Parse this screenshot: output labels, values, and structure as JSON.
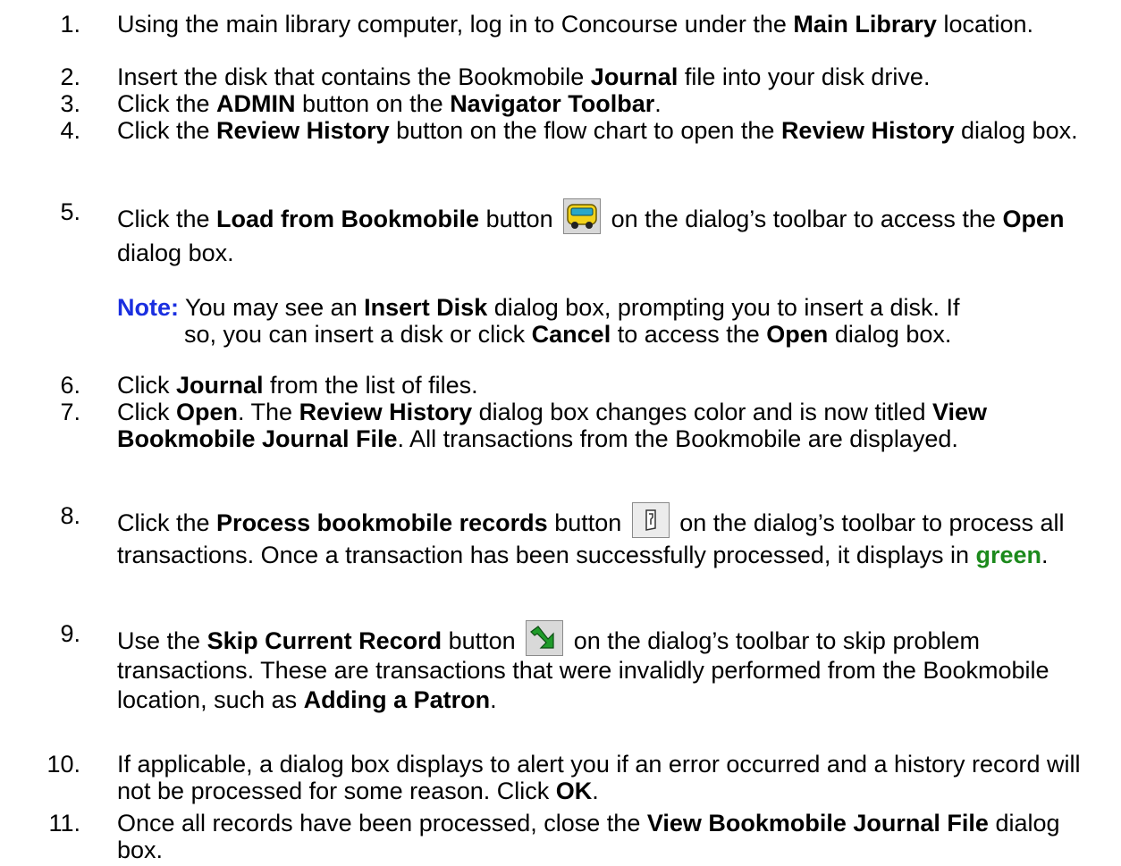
{
  "steps": [
    {
      "num": "1.",
      "pre": "Using the main library computer, log in to Concourse under the ",
      "b1": "Main Library",
      "post": " location."
    },
    {
      "num": "2.",
      "pre": "Insert the disk that contains the Bookmobile ",
      "b1": "Journal",
      "post": " file into your disk drive."
    },
    {
      "num": "3.",
      "pre": "Click the ",
      "b1": "ADMIN",
      "mid": " button on the ",
      "b2": "Navigator Toolbar",
      "post": "."
    },
    {
      "num": "4.",
      "pre": "Click the ",
      "b1": "Review History",
      "mid": " button on the flow chart to open the ",
      "b2": "Review History",
      "post": " dialog box."
    },
    {
      "num": "5.",
      "pre": "Click the ",
      "b1": "Load from Bookmobile",
      "mid": " button ",
      "icon": "bookmobile-bus-icon",
      "mid2": " on the dialog’s toolbar to access the ",
      "b2": "Open",
      "post": " dialog box."
    },
    {
      "num": "6.",
      "pre": "Click ",
      "b1": "Journal",
      "post": " from the list of files."
    },
    {
      "num": "7.",
      "pre": "Click ",
      "b1": "Open",
      "mid": ". The ",
      "b2": "Review History",
      "mid2": " dialog box changes color and is now titled ",
      "b3": "View Bookmobile Journal File",
      "post": ". All transactions from the Bookmobile are displayed."
    },
    {
      "num": "8.",
      "pre": "Click the ",
      "b1": "Process bookmobile records",
      "mid": " button ",
      "icon": "process-records-icon",
      "mid2": " on the dialog’s toolbar to process all transactions. Once a transaction has been successfully processed, it displays in ",
      "green": "green",
      "post": "."
    },
    {
      "num": "9.",
      "pre": "Use the ",
      "b1": "Skip Current Record",
      "mid": " button ",
      "icon": "skip-record-arrow-icon",
      "mid2": " on the dialog’s toolbar to skip problem transactions. These are transactions that were invalidly performed from the Bookmobile location, such as ",
      "b2": "Adding a Patron",
      "post": "."
    },
    {
      "num": "10.",
      "pre": "If applicable, a dialog box displays to alert you if an error occurred and a history record will not be processed for some reason. Click ",
      "b1": "OK",
      "post": "."
    },
    {
      "num": "11.",
      "pre": "Once all records have been processed, close the ",
      "b1": "View Bookmobile Journal File",
      "post": " dialog box."
    }
  ],
  "note": {
    "label": "Note:",
    "line1_pre": " You may see an ",
    "line1_b": "Insert Disk",
    "line1_post": " dialog box, prompting you to insert a disk. If",
    "line2_pre": "so, you can insert a disk or click ",
    "line2_b1": "Cancel",
    "line2_mid": " to access the ",
    "line2_b2": "Open",
    "line2_post": " dialog box."
  },
  "colors": {
    "note_label": "#1a2fe0",
    "green_text": "#1c8a1c"
  }
}
